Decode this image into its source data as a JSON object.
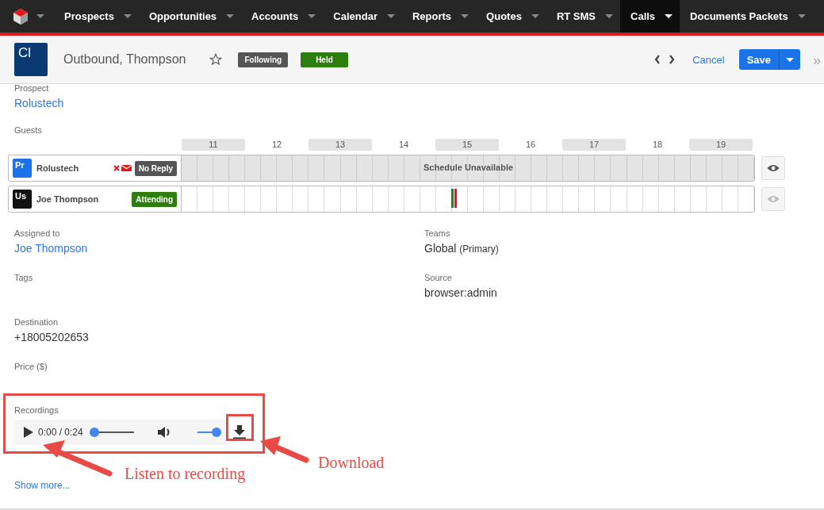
{
  "nav": {
    "items": [
      {
        "label": "Prospects",
        "selected": false
      },
      {
        "label": "Opportunities",
        "selected": false
      },
      {
        "label": "Accounts",
        "selected": false
      },
      {
        "label": "Calendar",
        "selected": false
      },
      {
        "label": "Reports",
        "selected": false
      },
      {
        "label": "Quotes",
        "selected": false
      },
      {
        "label": "RT SMS",
        "selected": false
      },
      {
        "label": "Calls",
        "selected": true
      },
      {
        "label": "Documents Packets",
        "selected": false
      }
    ],
    "more": "»"
  },
  "header": {
    "avatar": "Cl",
    "title": "Outbound, Thompson",
    "favorite": false,
    "badges": [
      {
        "label": "Following",
        "color": "#555555"
      },
      {
        "label": "Held",
        "color": "#2e7d0f"
      }
    ],
    "cancel": "Cancel",
    "save": "Save"
  },
  "prospect": {
    "label": "Prospect",
    "value": "Rolustech"
  },
  "guests": {
    "label": "Guests",
    "hours": [
      "11",
      "12",
      "13",
      "14",
      "15",
      "16",
      "17",
      "18",
      "19"
    ],
    "rows": [
      {
        "avatar": {
          "text": "Pr",
          "color": "#1a73e8"
        },
        "name": "Rolustech",
        "invite_failed": true,
        "status": {
          "label": "No Reply",
          "color": "#555555"
        },
        "schedule": "Schedule Unavailable",
        "busy": false,
        "eye_enabled": true
      },
      {
        "avatar": {
          "text": "Us",
          "color": "#111111"
        },
        "name": "Joe Thompson",
        "invite_failed": false,
        "status": {
          "label": "Attending",
          "color": "#2e7d0f"
        },
        "busy": true,
        "eye_enabled": false
      }
    ]
  },
  "fields_left": [
    {
      "label": "Assigned to",
      "value": "Joe Thompson",
      "kind": "link"
    },
    {
      "label": "Tags",
      "kind": "empty"
    },
    {
      "label": "Destination",
      "value": "+18005202653",
      "kind": "text"
    },
    {
      "label": "Price ($)",
      "kind": "empty"
    }
  ],
  "fields_right": [
    {
      "label": "Teams",
      "value": "Global",
      "note": "(Primary)",
      "kind": "text"
    },
    {
      "label": "Source",
      "value": "browser:admin",
      "kind": "text"
    }
  ],
  "recordings": {
    "label": "Recordings",
    "time": "0:00 / 0:24",
    "progress": {
      "level": 0
    },
    "volume": {
      "level": 1
    }
  },
  "show_more": "Show more...",
  "annotations": [
    {
      "text": "Listen to recording",
      "kind": "player"
    },
    {
      "text": "Download",
      "kind": "download"
    }
  ]
}
